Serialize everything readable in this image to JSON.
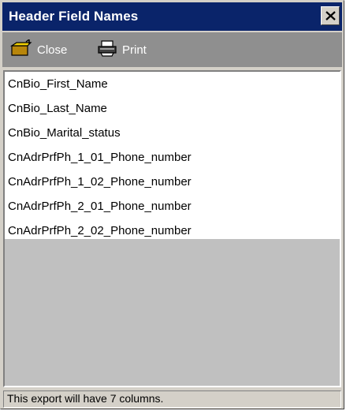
{
  "window": {
    "title": "Header Field Names"
  },
  "toolbar": {
    "close_label": "Close",
    "print_label": "Print",
    "close_icon": "folder-close-icon",
    "print_icon": "printer-icon"
  },
  "list": {
    "items": [
      "CnBio_First_Name",
      "CnBio_Last_Name",
      "CnBio_Marital_status",
      "CnAdrPrfPh_1_01_Phone_number",
      "CnAdrPrfPh_1_02_Phone_number",
      "CnAdrPrfPh_2_01_Phone_number",
      "CnAdrPrfPh_2_02_Phone_number"
    ]
  },
  "status": {
    "text": "This export will have 7 columns."
  },
  "colors": {
    "titlebar": "#0a246a",
    "toolbar": "#8f8f8f",
    "window_face": "#d4d0c8",
    "list_background": "#ffffff",
    "list_empty": "#c0c0c0"
  }
}
